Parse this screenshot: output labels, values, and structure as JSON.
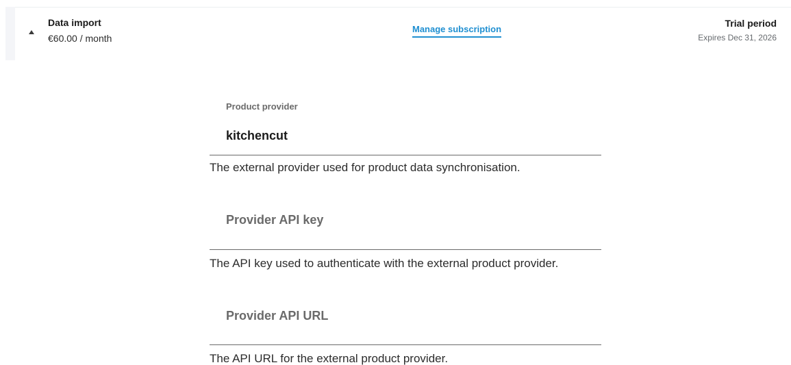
{
  "subscription": {
    "name": "Data import",
    "price": "€60.00 / month",
    "manage_label": "Manage subscription",
    "status": "Trial period",
    "expiry": "Expires Dec 31, 2026"
  },
  "fields": {
    "provider": {
      "label": "Product provider",
      "value": "kitchencut",
      "help": "The external provider used for product data synchronisation."
    },
    "api_key": {
      "label": "Provider API key",
      "value": "",
      "help": "The API key used to authenticate with the external product provider."
    },
    "api_url": {
      "label": "Provider API URL",
      "value": "",
      "help": "The API URL for the external product provider."
    }
  },
  "colors": {
    "accent": "#1f8fd1",
    "muted_label": "#6a6a6a",
    "rail": "#f4f5f8"
  }
}
